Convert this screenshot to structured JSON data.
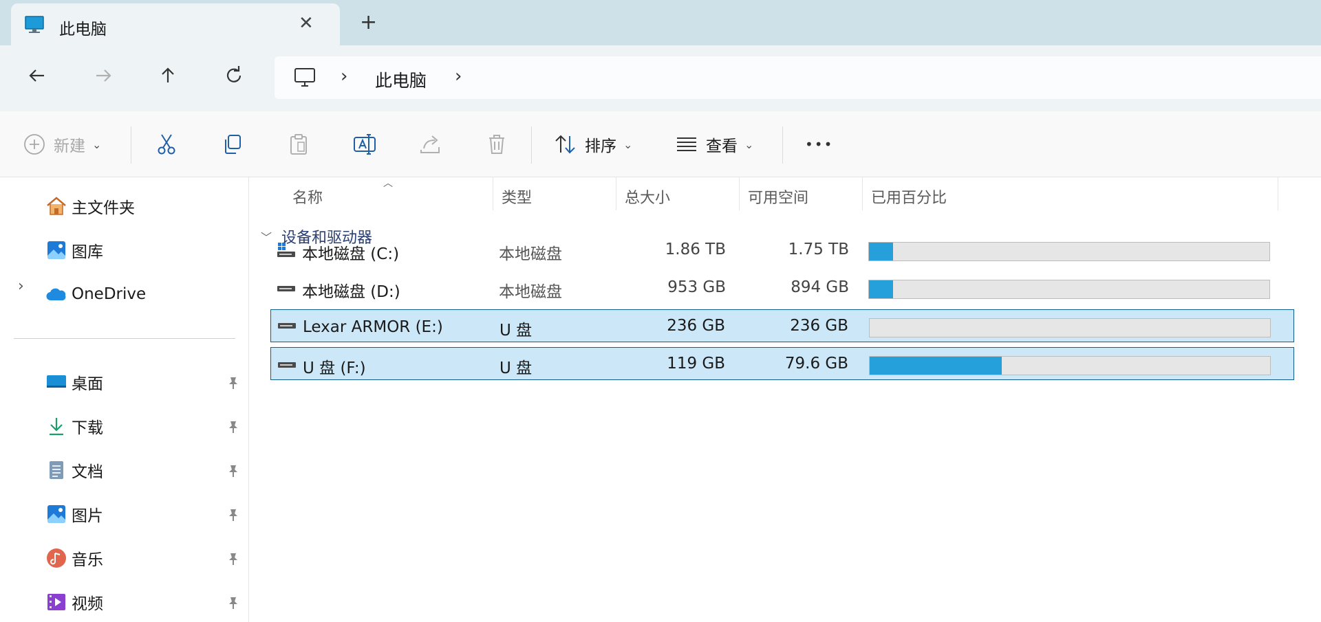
{
  "tab": {
    "title": "此电脑",
    "close": "✕",
    "new_tab": "+"
  },
  "address": {
    "separator": "›",
    "location": "此电脑"
  },
  "commands": {
    "new_label": "新建",
    "sort_label": "排序",
    "view_label": "查看",
    "more": "•••"
  },
  "sidebar": {
    "items": [
      {
        "label": "主文件夹",
        "icon": "home-icon"
      },
      {
        "label": "图库",
        "icon": "gallery-icon"
      },
      {
        "label": "OneDrive",
        "icon": "onedrive-icon"
      }
    ],
    "quick_access": [
      {
        "label": "桌面",
        "icon": "desktop-icon"
      },
      {
        "label": "下载",
        "icon": "download-icon"
      },
      {
        "label": "文档",
        "icon": "documents-icon"
      },
      {
        "label": "图片",
        "icon": "pictures-icon"
      },
      {
        "label": "音乐",
        "icon": "music-icon"
      },
      {
        "label": "视频",
        "icon": "videos-icon"
      }
    ]
  },
  "columns": [
    "名称",
    "类型",
    "总大小",
    "可用空间",
    "已用百分比"
  ],
  "group": {
    "title": "设备和驱动器"
  },
  "drives": [
    {
      "name": "本地磁盘 (C:)",
      "type": "本地磁盘",
      "total": "1.86 TB",
      "free": "1.75 TB",
      "used_fraction": 0.06,
      "selected": false,
      "icon": "system-drive-icon"
    },
    {
      "name": "本地磁盘 (D:)",
      "type": "本地磁盘",
      "total": "953 GB",
      "free": "894 GB",
      "used_fraction": 0.06,
      "selected": false,
      "icon": "drive-icon"
    },
    {
      "name": "Lexar ARMOR (E:)",
      "type": "U 盘",
      "total": "236 GB",
      "free": "236 GB",
      "used_fraction": 0.0,
      "selected": true,
      "icon": "usb-drive-icon"
    },
    {
      "name": "U 盘 (F:)",
      "type": "U 盘",
      "total": "119 GB",
      "free": "79.6 GB",
      "used_fraction": 0.33,
      "selected": true,
      "icon": "usb-drive-icon"
    }
  ],
  "colors": {
    "accent": "#26a0da",
    "selection": "#cce8f8",
    "selection_border": "#0f5d8f"
  }
}
